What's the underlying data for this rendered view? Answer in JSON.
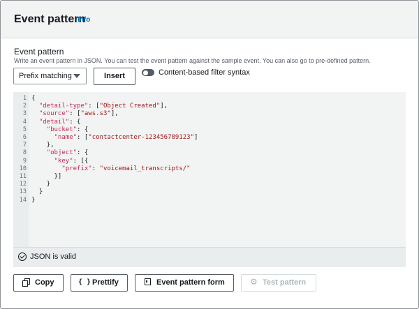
{
  "header": {
    "title": "Event pattern",
    "info_link": "Info"
  },
  "field": {
    "label": "Event pattern",
    "description": "Write an event pattern in JSON. You can test the event pattern against the sample event. You can also go to pre-defined pattern."
  },
  "controls": {
    "select_value": "Prefix matching",
    "insert_label": "Insert",
    "toggle_label": "Content-based filter syntax",
    "toggle_on": false
  },
  "editor": {
    "line_numbers": [
      "1",
      "2",
      "3",
      "4",
      "5",
      "6",
      "7",
      "8",
      "9",
      "10",
      "11",
      "12",
      "13",
      "14"
    ],
    "lines": [
      "{",
      "  \"detail-type\": [\"Object Created\"],",
      "  \"source\": [\"aws.s3\"],",
      "  \"detail\": {",
      "    \"bucket\": {",
      "      \"name\": [\"contactcenter-123456789123\"]",
      "    },",
      "    \"object\": {",
      "      \"key\": [{",
      "        \"prefix\": \"voicemail_transcripts/\"",
      "      }]",
      "    }",
      "  }",
      "}"
    ],
    "status": "JSON is valid"
  },
  "actions": {
    "copy": "Copy",
    "prettify": "Prettify",
    "prettify_icon_text": "{ }",
    "event_pattern_form": "Event pattern form",
    "test_pattern": "Test pattern"
  },
  "colors": {
    "accent": "#0073bb",
    "json_key": "#c7254e",
    "json_string": "#a31515",
    "disabled": "#aab7b8"
  }
}
